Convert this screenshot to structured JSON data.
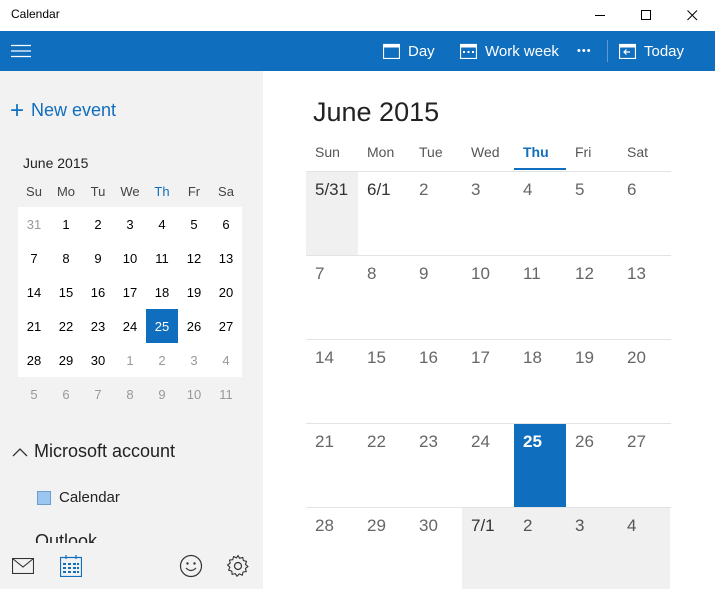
{
  "window": {
    "title": "Calendar"
  },
  "toolbar": {
    "day_label": "Day",
    "work_week_label": "Work week",
    "more_label": "•••",
    "today_label": "Today"
  },
  "sidebar": {
    "new_event_label": "New event",
    "mini_calendar": {
      "title": "June 2015",
      "weekdays": [
        "Su",
        "Mo",
        "Tu",
        "We",
        "Th",
        "Fr",
        "Sa"
      ],
      "today_index": 4,
      "weeks": [
        [
          "31",
          "1",
          "2",
          "3",
          "4",
          "5",
          "6"
        ],
        [
          "7",
          "8",
          "9",
          "10",
          "11",
          "12",
          "13"
        ],
        [
          "14",
          "15",
          "16",
          "17",
          "18",
          "19",
          "20"
        ],
        [
          "21",
          "22",
          "23",
          "24",
          "25",
          "26",
          "27"
        ],
        [
          "28",
          "29",
          "30",
          "1",
          "2",
          "3",
          "4"
        ],
        [
          "5",
          "6",
          "7",
          "8",
          "9",
          "10",
          "11"
        ]
      ],
      "selected": "25"
    },
    "account_label": "Microsoft account",
    "calendar_item_label": "Calendar",
    "next_account_label": "Outlook",
    "calendar_color": "#9ac6ef"
  },
  "main": {
    "month_title": "June 2015",
    "weekdays": [
      "Sun",
      "Mon",
      "Tue",
      "Wed",
      "Thu",
      "Fri",
      "Sat"
    ],
    "today_index": 4,
    "weeks": [
      [
        "5/31",
        "6/1",
        "2",
        "3",
        "4",
        "5",
        "6"
      ],
      [
        "7",
        "8",
        "9",
        "10",
        "11",
        "12",
        "13"
      ],
      [
        "14",
        "15",
        "16",
        "17",
        "18",
        "19",
        "20"
      ],
      [
        "21",
        "22",
        "23",
        "24",
        "25",
        "26",
        "27"
      ],
      [
        "28",
        "29",
        "30",
        "7/1",
        "2",
        "3",
        "4"
      ]
    ],
    "selected": "25"
  },
  "colors": {
    "accent": "#106ebe",
    "pane_background": "#f2f2f2",
    "other_month_background": "#f0f0f0"
  }
}
